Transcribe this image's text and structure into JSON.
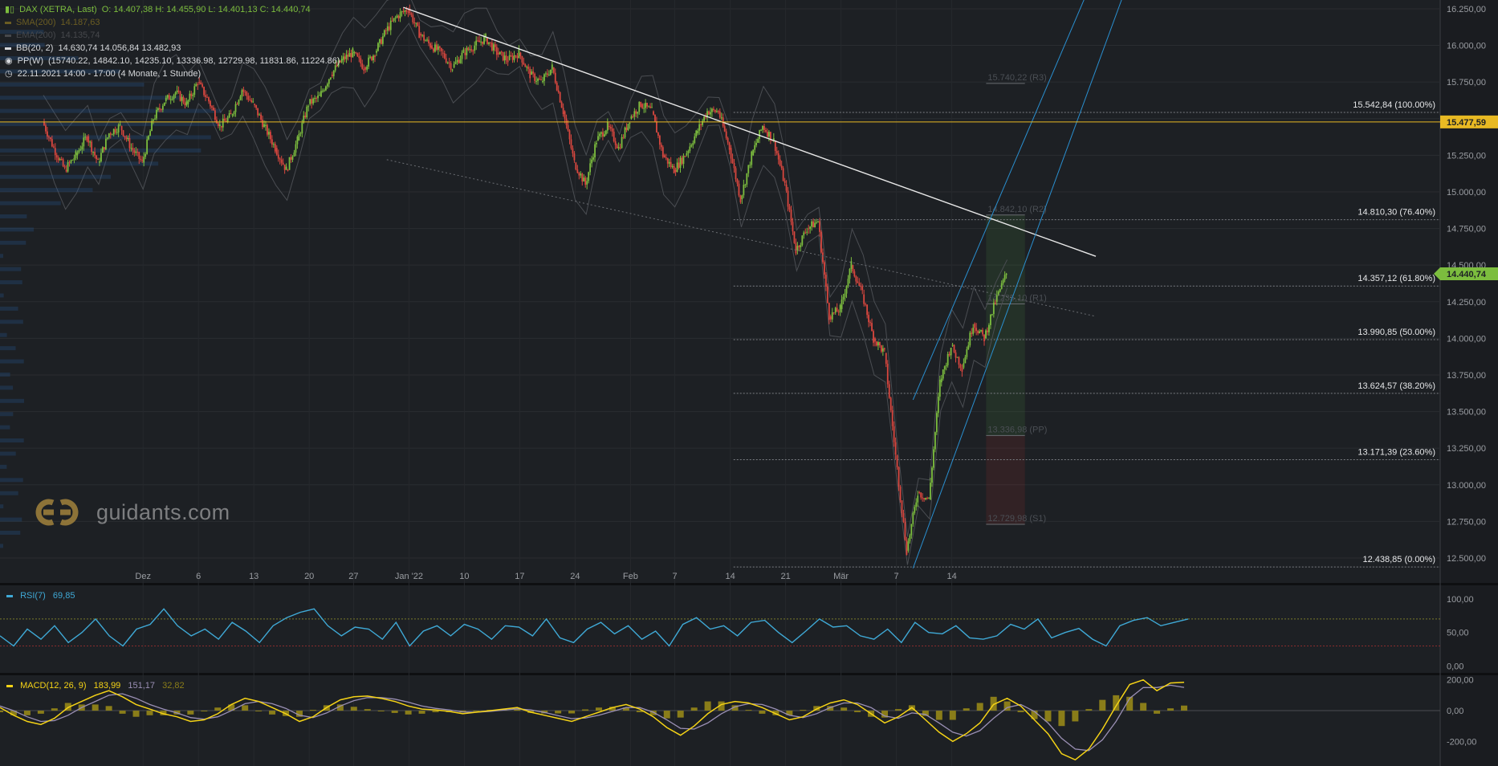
{
  "legend": {
    "title": "DAX (XETRA, Last)",
    "ohlc": "O: 14.407,38  H: 14.455,90  L: 14.401,13  C: 14.440,74",
    "sma_name": "SMA(200)",
    "sma_value": "14.187,63",
    "ema_name": "EMA(200)",
    "ema_value": "14.135,74",
    "bb_name": "BB(20, 2)",
    "bb_values": "14.630,74  14.056,84  13.482,93",
    "pp_name": "PP(W)",
    "pp_values": "(15740.22, 14842.10, 14235.10, 13336.98, 12729.98, 11831.86, 11224.86)",
    "range_text": "22.11.2021 14:00 - 17:00   (4 Monate, 1 Stunde)"
  },
  "watermark": "guidants.com",
  "rsi_panel": {
    "name": "RSI(7)",
    "value": "69,85"
  },
  "macd_panel": {
    "name": "MACD(12, 26, 9)",
    "value": "183,99",
    "signal": "151,17",
    "hist": "32,82"
  },
  "colors": {
    "background": "#1d2024",
    "up": "#7cbd3e",
    "down": "#d9473f",
    "trend_white": "#e8e8e8",
    "channel_blue": "#2a8fd0",
    "price_line": "#e8b923",
    "rsi": "#3fa9d6",
    "macd": "#f5d316",
    "signal": "#9a8fb4",
    "hist": "#8a7d19",
    "last_price": "#7cbd3e"
  },
  "chart_data": [
    {
      "type": "candlestick",
      "title": "DAX (XETRA, Last)",
      "ylim": [
        12330,
        16310
      ],
      "y_ticks": [
        "16.250,00",
        "16.000,00",
        "15.750,00",
        "15.500,00",
        "15.250,00",
        "15.000,00",
        "14.750,00",
        "14.500,00",
        "14.250,00",
        "14.000,00",
        "13.750,00",
        "13.500,00",
        "13.250,00",
        "13.000,00",
        "12.750,00",
        "12.500,00"
      ],
      "y_tick_values": [
        16250,
        16000,
        15750,
        15500,
        15250,
        15000,
        14750,
        14500,
        14250,
        14000,
        13750,
        13500,
        13250,
        13000,
        12750,
        12500
      ],
      "x_labels": [
        "Dez",
        "6",
        "13",
        "20",
        "27",
        "Jan '22",
        "10",
        "17",
        "24",
        "Feb",
        "7",
        "14",
        "21",
        "Mär",
        "7",
        "14"
      ],
      "x_label_days": [
        9,
        14,
        19,
        24,
        28,
        33,
        38,
        43,
        48,
        53,
        57,
        62,
        67,
        72,
        77,
        82
      ],
      "price_path": [
        [
          0,
          15480
        ],
        [
          1,
          15300
        ],
        [
          2,
          15150
        ],
        [
          3,
          15250
        ],
        [
          4,
          15380
        ],
        [
          5,
          15200
        ],
        [
          6,
          15400
        ],
        [
          7,
          15450
        ],
        [
          8,
          15300
        ],
        [
          9,
          15200
        ],
        [
          10,
          15500
        ],
        [
          11,
          15620
        ],
        [
          12,
          15680
        ],
        [
          13,
          15600
        ],
        [
          14,
          15750
        ],
        [
          15,
          15620
        ],
        [
          16,
          15450
        ],
        [
          17,
          15520
        ],
        [
          18,
          15700
        ],
        [
          19,
          15600
        ],
        [
          20,
          15450
        ],
        [
          21,
          15300
        ],
        [
          22,
          15150
        ],
        [
          23,
          15350
        ],
        [
          24,
          15600
        ],
        [
          25,
          15650
        ],
        [
          26,
          15800
        ],
        [
          27,
          15900
        ],
        [
          28,
          15950
        ],
        [
          29,
          15850
        ],
        [
          30,
          15950
        ],
        [
          31,
          16100
        ],
        [
          32,
          16200
        ],
        [
          33,
          16250
        ],
        [
          34,
          16080
        ],
        [
          35,
          16000
        ],
        [
          36,
          15950
        ],
        [
          37,
          15850
        ],
        [
          38,
          15950
        ],
        [
          39,
          16000
        ],
        [
          40,
          16050
        ],
        [
          41,
          15950
        ],
        [
          42,
          15900
        ],
        [
          43,
          15950
        ],
        [
          44,
          15800
        ],
        [
          45,
          15750
        ],
        [
          46,
          15850
        ],
        [
          47,
          15550
        ],
        [
          48,
          15200
        ],
        [
          49,
          15050
        ],
        [
          50,
          15350
        ],
        [
          51,
          15450
        ],
        [
          52,
          15300
        ],
        [
          53,
          15500
        ],
        [
          54,
          15600
        ],
        [
          55,
          15550
        ],
        [
          56,
          15250
        ],
        [
          57,
          15150
        ],
        [
          58,
          15250
        ],
        [
          59,
          15400
        ],
        [
          60,
          15550
        ],
        [
          61,
          15550
        ],
        [
          62,
          15300
        ],
        [
          63,
          14950
        ],
        [
          64,
          15250
        ],
        [
          65,
          15450
        ],
        [
          66,
          15350
        ],
        [
          67,
          15050
        ],
        [
          68,
          14600
        ],
        [
          69,
          14750
        ],
        [
          70,
          14800
        ],
        [
          71,
          14150
        ],
        [
          72,
          14200
        ],
        [
          73,
          14500
        ],
        [
          74,
          14300
        ],
        [
          75,
          14000
        ],
        [
          76,
          13900
        ],
        [
          77,
          13200
        ],
        [
          78,
          12550
        ],
        [
          79,
          12950
        ],
        [
          80,
          12900
        ],
        [
          81,
          13700
        ],
        [
          82,
          13950
        ],
        [
          83,
          13800
        ],
        [
          84,
          14100
        ],
        [
          85,
          14000
        ],
        [
          86,
          14250
        ],
        [
          87,
          14441
        ]
      ],
      "pivot_levels": [
        {
          "label": "15.740,22 (R3)",
          "value": 15740.22
        },
        {
          "label": "14.842,10 (R2)",
          "value": 14842.1
        },
        {
          "label": "14.235,10 (R1)",
          "value": 14235.1
        },
        {
          "label": "13.336,98 (PP)",
          "value": 13336.98
        },
        {
          "label": "12.729,98 (S1)",
          "value": 12729.98
        }
      ],
      "fib_levels": [
        {
          "label": "15.542,84 (100.00%)",
          "value": 15542.84
        },
        {
          "label": "14.810,30 (76.40%)",
          "value": 14810.3
        },
        {
          "label": "14.357,12 (61.80%)",
          "value": 14357.12
        },
        {
          "label": "13.990,85 (50.00%)",
          "value": 13990.85
        },
        {
          "label": "13.624,57 (38.20%)",
          "value": 13624.57
        },
        {
          "label": "13.171,39 (23.60%)",
          "value": 13171.39
        },
        {
          "label": "12.438,85 (0.00%)",
          "value": 12438.85
        }
      ],
      "horizontal_line": {
        "label": "15.477,59",
        "value": 15477.59
      },
      "last_price": {
        "label": "14.440,74",
        "value": 14440.74
      },
      "trendlines": [
        {
          "name": "white",
          "from": [
            32.5,
            16260
          ],
          "to": [
            95,
            14560
          ]
        },
        {
          "name": "blue1",
          "from": [
            78.5,
            13580
          ],
          "to": [
            95,
            16500
          ]
        },
        {
          "name": "blue2",
          "from": [
            78.5,
            12430
          ],
          "to": [
            98,
            16450
          ]
        },
        {
          "name": "gray-dot",
          "from": [
            31,
            15220
          ],
          "to": [
            95,
            14150
          ]
        }
      ]
    },
    {
      "type": "line",
      "title": "RSI(7)",
      "ylim": [
        -10,
        120
      ],
      "y_ticks": [
        "100,00",
        "50,00",
        "0,00"
      ],
      "y_tick_values": [
        100,
        50,
        0
      ],
      "levels": [
        70,
        30
      ],
      "values": [
        45,
        30,
        55,
        40,
        60,
        35,
        50,
        70,
        45,
        30,
        55,
        62,
        85,
        60,
        45,
        55,
        40,
        65,
        52,
        35,
        60,
        72,
        80,
        85,
        60,
        45,
        58,
        55,
        40,
        65,
        30,
        52,
        60,
        45,
        62,
        55,
        40,
        60,
        58,
        45,
        70,
        42,
        35,
        55,
        65,
        48,
        60,
        40,
        52,
        30,
        62,
        72,
        55,
        60,
        45,
        65,
        68,
        50,
        35,
        52,
        70,
        58,
        60,
        45,
        40,
        55,
        35,
        65,
        50,
        48,
        60,
        42,
        40,
        45,
        62,
        55,
        70,
        42,
        50,
        56,
        40,
        30,
        60,
        68,
        72,
        60,
        65,
        70
      ]
    },
    {
      "type": "line",
      "title": "MACD(12, 26, 9)",
      "ylim": [
        -360,
        230
      ],
      "y_ticks": [
        "200,00",
        "0,00",
        "-200,00"
      ],
      "y_tick_values": [
        200,
        0,
        -200
      ],
      "macd": [
        20,
        -30,
        -70,
        -90,
        -50,
        20,
        60,
        100,
        130,
        90,
        40,
        10,
        -20,
        -40,
        -70,
        -60,
        -20,
        40,
        80,
        60,
        20,
        -20,
        -70,
        -40,
        20,
        70,
        90,
        95,
        80,
        60,
        30,
        10,
        5,
        -5,
        -20,
        -10,
        0,
        10,
        20,
        -10,
        -30,
        -50,
        -70,
        -40,
        -10,
        20,
        40,
        10,
        -40,
        -110,
        -160,
        -100,
        -20,
        40,
        60,
        50,
        20,
        -20,
        -60,
        -40,
        10,
        50,
        70,
        40,
        -20,
        -80,
        -40,
        20,
        -60,
        -140,
        -200,
        -150,
        -80,
        40,
        80,
        30,
        -60,
        -150,
        -280,
        -320,
        -250,
        -120,
        30,
        170,
        200,
        130,
        180,
        184
      ],
      "signal": [
        30,
        0,
        -40,
        -70,
        -65,
        -30,
        20,
        60,
        100,
        110,
        80,
        40,
        10,
        -15,
        -45,
        -55,
        -40,
        0,
        45,
        60,
        45,
        15,
        -30,
        -45,
        -15,
        30,
        65,
        85,
        85,
        75,
        55,
        30,
        15,
        5,
        -8,
        -10,
        -5,
        4,
        12,
        5,
        -12,
        -32,
        -52,
        -48,
        -30,
        -5,
        20,
        20,
        -10,
        -60,
        -115,
        -120,
        -80,
        -20,
        25,
        45,
        40,
        10,
        -30,
        -45,
        -20,
        20,
        50,
        50,
        20,
        -35,
        -50,
        -15,
        -25,
        -80,
        -140,
        -165,
        -130,
        -50,
        20,
        40,
        -5,
        -80,
        -180,
        -250,
        -260,
        -190,
        -70,
        80,
        150,
        150,
        165,
        151
      ]
    }
  ]
}
